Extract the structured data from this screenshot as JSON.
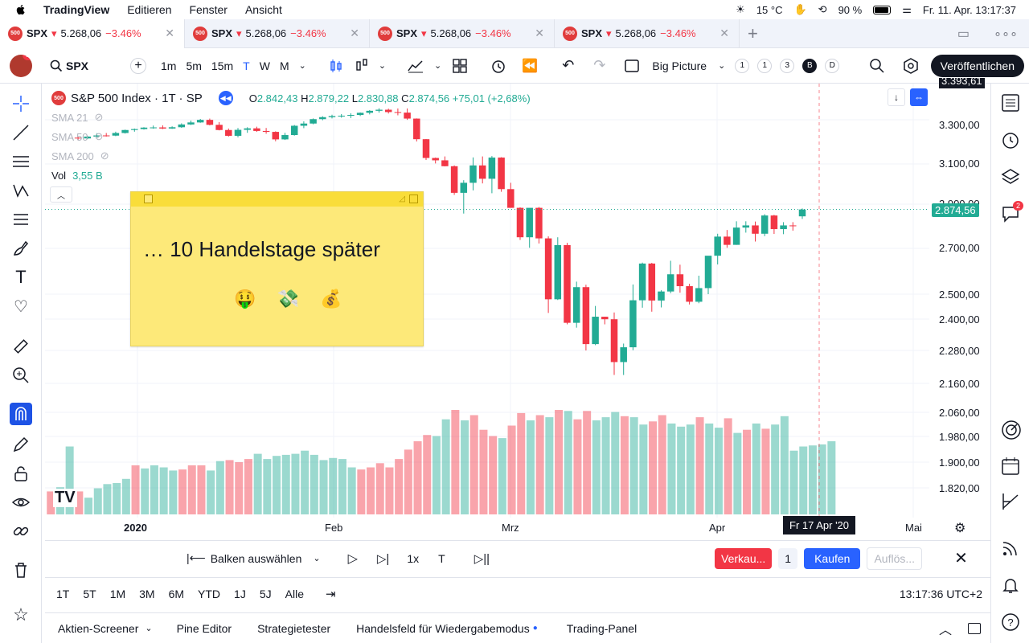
{
  "menubar": {
    "app_name": "TradingView",
    "menus": [
      "Editieren",
      "Fenster",
      "Ansicht"
    ],
    "temperature": "15 °C",
    "battery": "90 %",
    "datetime": "Fr. 11. Apr. 13:17:37"
  },
  "tabs": [
    {
      "symbol": "SPX",
      "price": "5.268,06",
      "change": "−3.46%",
      "active": true
    },
    {
      "symbol": "SPX",
      "price": "5.268,06",
      "change": "−3.46%",
      "active": false
    },
    {
      "symbol": "SPX",
      "price": "5.268,06",
      "change": "−3.46%",
      "active": false
    },
    {
      "symbol": "SPX",
      "price": "5.268,06",
      "change": "−3.46%",
      "active": false
    }
  ],
  "toolbar": {
    "avatar_badge": "11",
    "symbol": "SPX",
    "intervals": [
      "1m",
      "5m",
      "15m",
      "T",
      "W",
      "M"
    ],
    "active_interval": "T",
    "layout_name": "Big Picture",
    "layout_slots": [
      "1",
      "1",
      "3",
      "B",
      "D"
    ],
    "publish_label": "Veröffentlichen"
  },
  "legend": {
    "logo": "500",
    "title": "S&P 500 Index · 1T · SP",
    "open_label": "O",
    "open": "2.842,43",
    "high_label": "H",
    "high": "2.879,22",
    "low_label": "L",
    "low": "2.830,88",
    "close_label": "C",
    "close": "2.874,56",
    "change": "+75,01 (+2,68%)",
    "indicators": [
      "SMA 21",
      "SMA 50",
      "SMA 200"
    ],
    "volume_label": "Vol",
    "volume": "3,55 B"
  },
  "sticky_note": {
    "text": "… 10 Handelstage später",
    "emoji": "🤑 💸 💰"
  },
  "price_scale": {
    "labels": [
      "3.300,00",
      "3.100,00",
      "2.900,00",
      "2.700,00",
      "2.500,00",
      "2.400,00",
      "2.280,00",
      "2.160,00",
      "2.060,00",
      "1.980,00",
      "1.900,00",
      "1.820,00"
    ],
    "top_label": "3.393,61",
    "current_price": "2.874,56"
  },
  "time_scale": {
    "labels": [
      "2020",
      "Feb",
      "Mrz",
      "Apr",
      "Mai"
    ],
    "cursor_label": "Fr 17 Apr '20"
  },
  "replay_bar": {
    "select_bars": "Balken auswählen",
    "speed": "1x",
    "interval": "T",
    "sell_label": "Verkau...",
    "qty": "1",
    "buy_label": "Kaufen",
    "resolve_label": "Auflös..."
  },
  "date_ranges": {
    "ranges": [
      "1T",
      "5T",
      "1M",
      "3M",
      "6M",
      "YTD",
      "1J",
      "5J",
      "Alle"
    ],
    "clock": "13:17:36 UTC+2"
  },
  "bottom_panel": {
    "tabs": [
      "Aktien-Screener",
      "Pine Editor",
      "Strategietester",
      "Handelsfeld für Wiedergabemodus",
      "Trading-Panel"
    ]
  },
  "right_badge": "2",
  "colors": {
    "up": "#22ab94",
    "down": "#f23645",
    "accent": "#2962ff",
    "sticky": "#fde979"
  },
  "chart_data": {
    "type": "candlestick",
    "symbol": "S&P 500 Index",
    "interval": "1T",
    "candles": [
      [
        3234,
        3240,
        3220,
        3230
      ],
      [
        3230,
        3244,
        3226,
        3240
      ],
      [
        3240,
        3258,
        3236,
        3246
      ],
      [
        3246,
        3259,
        3240,
        3245
      ],
      [
        3245,
        3266,
        3242,
        3259
      ],
      [
        3259,
        3277,
        3256,
        3275
      ],
      [
        3275,
        3283,
        3266,
        3280
      ],
      [
        3280,
        3290,
        3277,
        3288
      ],
      [
        3288,
        3299,
        3282,
        3289
      ],
      [
        3289,
        3300,
        3280,
        3283
      ],
      [
        3283,
        3295,
        3281,
        3290
      ],
      [
        3290,
        3311,
        3287,
        3305
      ],
      [
        3305,
        3326,
        3302,
        3316
      ],
      [
        3316,
        3335,
        3314,
        3330
      ],
      [
        3330,
        3337,
        3300,
        3303
      ],
      [
        3303,
        3318,
        3273,
        3275
      ],
      [
        3275,
        3283,
        3240,
        3244
      ],
      [
        3244,
        3286,
        3236,
        3276
      ],
      [
        3276,
        3290,
        3260,
        3284
      ],
      [
        3284,
        3293,
        3265,
        3270
      ],
      [
        3270,
        3286,
        3255,
        3265
      ],
      [
        3265,
        3268,
        3215,
        3225
      ],
      [
        3225,
        3260,
        3222,
        3248
      ],
      [
        3248,
        3302,
        3245,
        3298
      ],
      [
        3298,
        3322,
        3285,
        3310
      ],
      [
        3310,
        3338,
        3306,
        3334
      ],
      [
        3334,
        3350,
        3328,
        3345
      ],
      [
        3345,
        3358,
        3338,
        3351
      ],
      [
        3351,
        3362,
        3342,
        3353
      ],
      [
        3353,
        3366,
        3340,
        3357
      ],
      [
        3357,
        3371,
        3351,
        3369
      ],
      [
        3369,
        3384,
        3360,
        3380
      ],
      [
        3380,
        3394,
        3370,
        3386
      ],
      [
        3386,
        3392,
        3365,
        3373
      ],
      [
        3373,
        3393,
        3355,
        3370
      ],
      [
        3370,
        3393,
        3330,
        3337
      ],
      [
        3337,
        3338,
        3214,
        3226
      ],
      [
        3226,
        3227,
        3118,
        3128
      ],
      [
        3128,
        3130,
        3100,
        3116
      ],
      [
        3116,
        3136,
        3085,
        3086
      ],
      [
        3086,
        3090,
        2944,
        2954
      ],
      [
        2954,
        3016,
        2855,
        3003
      ],
      [
        3003,
        3131,
        2966,
        3090
      ],
      [
        3090,
        3136,
        3000,
        3023
      ],
      [
        3023,
        3138,
        2952,
        3130
      ],
      [
        3130,
        3132,
        2959,
        2972
      ],
      [
        2972,
        3003,
        2882,
        2882
      ],
      [
        2882,
        2884,
        2734,
        2746
      ],
      [
        2746,
        2862,
        2699,
        2882
      ],
      [
        2882,
        2886,
        2718,
        2741
      ],
      [
        2741,
        2750,
        2425,
        2480
      ],
      [
        2480,
        2746,
        2477,
        2711
      ],
      [
        2711,
        2721,
        2380,
        2386
      ],
      [
        2386,
        2553,
        2367,
        2530
      ],
      [
        2530,
        2540,
        2280,
        2304
      ],
      [
        2304,
        2453,
        2300,
        2410
      ],
      [
        2410,
        2410,
        2380,
        2400
      ],
      [
        2400,
        2427,
        2190,
        2237
      ],
      [
        2237,
        2306,
        2190,
        2292
      ],
      [
        2292,
        2541,
        2281,
        2476
      ],
      [
        2476,
        2634,
        2446,
        2630
      ],
      [
        2630,
        2633,
        2430,
        2475
      ],
      [
        2475,
        2517,
        2447,
        2512
      ],
      [
        2512,
        2642,
        2505,
        2584
      ],
      [
        2584,
        2625,
        2507,
        2534
      ],
      [
        2534,
        2544,
        2459,
        2470
      ],
      [
        2470,
        2578,
        2464,
        2526
      ],
      [
        2526,
        2663,
        2501,
        2664
      ],
      [
        2664,
        2762,
        2626,
        2749
      ],
      [
        2749,
        2779,
        2699,
        2712
      ],
      [
        2712,
        2819,
        2712,
        2790
      ],
      [
        2790,
        2819,
        2767,
        2800
      ],
      [
        2800,
        2818,
        2727,
        2762
      ],
      [
        2762,
        2852,
        2751,
        2846
      ],
      [
        2846,
        2849,
        2761,
        2783
      ],
      [
        2783,
        2815,
        2760,
        2800
      ],
      [
        2800,
        2815,
        2776,
        2799
      ],
      [
        2842,
        2879,
        2830,
        2874
      ]
    ],
    "volume_relative": [
      0.22,
      0.26,
      0.65,
      0.22,
      0.16,
      0.25,
      0.29,
      0.3,
      0.34,
      0.47,
      0.44,
      0.47,
      0.45,
      0.42,
      0.43,
      0.47,
      0.47,
      0.42,
      0.51,
      0.52,
      0.5,
      0.53,
      0.58,
      0.53,
      0.56,
      0.57,
      0.58,
      0.61,
      0.57,
      0.52,
      0.54,
      0.53,
      0.45,
      0.43,
      0.45,
      0.49,
      0.45,
      0.53,
      0.62,
      0.7,
      0.76,
      0.75,
      0.91,
      1.0,
      0.9,
      0.95,
      0.81,
      0.75,
      0.73,
      0.85,
      0.97,
      0.9,
      0.95,
      0.93,
      1.0,
      0.99,
      0.91,
      0.99,
      0.9,
      0.93,
      0.98,
      0.94,
      0.93,
      0.86,
      0.89,
      0.95,
      0.87,
      0.84,
      0.86,
      0.93,
      0.87,
      0.83,
      0.92,
      0.78,
      0.81,
      0.87,
      0.82,
      0.86,
      0.94,
      0.61,
      0.65,
      0.66,
      0.67,
      0.7
    ],
    "current_price": 2874.56
  }
}
